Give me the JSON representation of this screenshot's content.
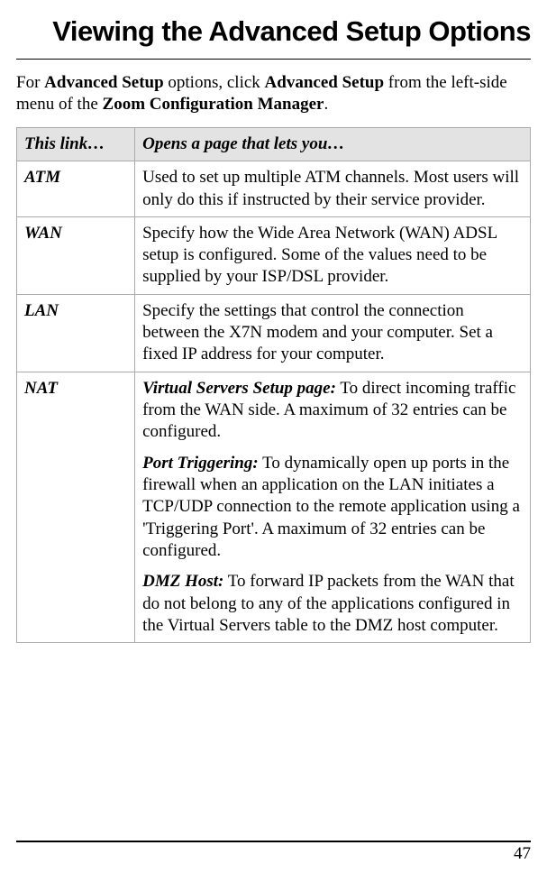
{
  "heading": "Viewing the Advanced Setup Options",
  "intro": {
    "prefix": "For ",
    "bold1": "Advanced Setup",
    "mid1": " options, click ",
    "bold2": "Advanced Setup",
    "mid2": " from the left-side menu of the ",
    "bold3": "Zoom Configuration Manager",
    "suffix": "."
  },
  "table": {
    "headers": {
      "col1": "This link…",
      "col2": "Opens a page that lets you…"
    },
    "rows": {
      "atm": {
        "link": "ATM",
        "desc": "Used to set up multiple ATM channels. Most users will only do this if instructed by their service provider."
      },
      "wan": {
        "link": "WAN",
        "desc": "Specify how the Wide Area Network (WAN) ADSL setup is configured. Some of the values need to be supplied by your ISP/DSL provider."
      },
      "lan": {
        "link": "LAN",
        "desc": "Specify the settings that control the connection between the X7N modem and your computer. Set a fixed IP address for your computer."
      },
      "nat": {
        "link": "NAT",
        "sections": {
          "virtual": {
            "label": "Virtual Servers Setup page:",
            "text": " To direct incoming traffic from the WAN side.  A maximum of 32 entries can be configured."
          },
          "port": {
            "label": "Port Triggering:",
            "text": " To dynamically open up ports in the firewall when an application on the LAN initiates a TCP/UDP connection to the remote application using a 'Triggering Port'. A maximum of 32 entries can be configured."
          },
          "dmz": {
            "label": "DMZ Host:",
            "text": " To forward IP packets from the WAN that do not belong to any of the applications configured in the Virtual Servers table to the DMZ host computer."
          }
        }
      }
    }
  },
  "page_number": "47"
}
